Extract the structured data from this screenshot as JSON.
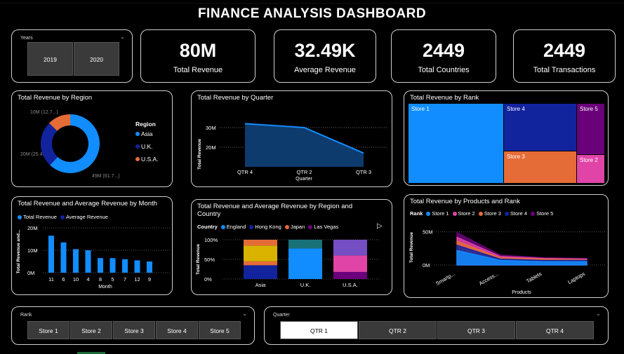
{
  "title": "FINANCE ANALYSIS DASHBOARD",
  "years_slicer": {
    "label": "Years",
    "options": [
      "2019",
      "2020"
    ]
  },
  "kpis": [
    {
      "value": "80M",
      "label": "Total Revenue"
    },
    {
      "value": "32.49K",
      "label": "Average Revenue"
    },
    {
      "value": "2449",
      "label": "Total Countries"
    },
    {
      "value": "2449",
      "label": "Total Transactions"
    }
  ],
  "rank_slicer": {
    "label": "Rank",
    "options": [
      "Store 1",
      "Store 2",
      "Store 3",
      "Store 4",
      "Store 5"
    ]
  },
  "quarter_slicer": {
    "label": "Quarter",
    "options": [
      "QTR 1",
      "QTR 2",
      "QTR 3",
      "QTR 4"
    ],
    "selected": "QTR 1"
  },
  "colors": {
    "blue": "#118dff",
    "navy": "#12239e",
    "orange": "#e66c37",
    "purple": "#6b007b",
    "pink": "#e044a7",
    "darkblue": "#1f3c88",
    "yellow": "#d9b300",
    "teal": "#197278",
    "gold": "#c9a100"
  },
  "chart_data": [
    {
      "id": "region",
      "type": "pie",
      "title": "Total Revenue by Region",
      "legend_title": "Region",
      "legend": [
        "Asia",
        "U.K.",
        "U.S.A."
      ],
      "values": [
        49,
        20,
        10
      ],
      "data_labels": [
        "49M (61.7...)",
        "20M (25.4...)",
        "10M (12.7...)"
      ],
      "colors": [
        "#118dff",
        "#12239e",
        "#e66c37"
      ]
    },
    {
      "id": "quarter",
      "type": "area",
      "title": "Total Revenue by Quarter",
      "categories": [
        "QTR 4",
        "QTR 2",
        "QTR 3"
      ],
      "values": [
        32,
        30,
        17
      ],
      "xlabel": "Quarter",
      "ylabel": "Total Revenue",
      "yticks": [
        "20M",
        "30M"
      ],
      "ylim": [
        10,
        35
      ]
    },
    {
      "id": "rank_treemap",
      "type": "treemap",
      "title": "Total Revenue by Rank",
      "items": [
        {
          "label": "Store 1",
          "color": "#118dff"
        },
        {
          "label": "Store 4",
          "color": "#12239e"
        },
        {
          "label": "Store 3",
          "color": "#e66c37"
        },
        {
          "label": "Store 5",
          "color": "#6b007b"
        },
        {
          "label": "Store 2",
          "color": "#e044a7"
        }
      ]
    },
    {
      "id": "month",
      "type": "bar",
      "title": "Total Revenue and Average Revenue by Month",
      "legend": [
        "Total Revenue",
        "Average Revenue"
      ],
      "legend_colors": [
        "#118dff",
        "#12239e"
      ],
      "categories": [
        "11",
        "6",
        "10",
        "4",
        "8",
        "5",
        "7",
        "12",
        "9"
      ],
      "series": [
        {
          "name": "Total Revenue",
          "values": [
            16.5,
            13.5,
            10.5,
            10,
            6.5,
            6.5,
            6,
            5.5,
            5
          ]
        }
      ],
      "xlabel": "Month",
      "ylabel": "Total Revenue and...",
      "yticks": [
        "0M",
        "10M",
        "20M"
      ],
      "ylim": [
        0,
        20
      ]
    },
    {
      "id": "region_country",
      "type": "bar",
      "title": "Total Revenue and Average Revenue by Region and Country",
      "legend_title": "Country",
      "legend": [
        "England",
        "Hong Kong",
        "Japan",
        "Las Vegas"
      ],
      "legend_colors": [
        "#118dff",
        "#12239e",
        "#e66c37",
        "#6b007b"
      ],
      "categories": [
        "Asia",
        "U.K.",
        "U.S.A."
      ],
      "ylabel": "Total Revenue",
      "yticks": [
        "0%",
        "50%",
        "100%"
      ],
      "stacks": [
        [
          {
            "v": 35,
            "c": "#12239e"
          },
          {
            "v": 10,
            "c": "#e66c37"
          },
          {
            "v": 40,
            "c": "#d9b300"
          },
          {
            "v": 15,
            "c": "#e66c37"
          }
        ],
        [
          {
            "v": 78,
            "c": "#118dff"
          },
          {
            "v": 22,
            "c": "#197278"
          }
        ],
        [
          {
            "v": 18,
            "c": "#6b007b"
          },
          {
            "v": 42,
            "c": "#e044a7"
          },
          {
            "v": 40,
            "c": "#744ec2"
          }
        ]
      ]
    },
    {
      "id": "products_rank",
      "type": "area",
      "title": "Total Revenue by Products and Rank",
      "legend_title": "Rank",
      "legend": [
        "Store 1",
        "Store 2",
        "Store 3",
        "Store 4",
        "Store 5"
      ],
      "legend_colors": [
        "#118dff",
        "#e044a7",
        "#e66c37",
        "#12239e",
        "#6b007b"
      ],
      "categories": [
        "Smartp...",
        "Access...",
        "Tablets",
        "Laptops"
      ],
      "series": [
        {
          "name": "Store 5",
          "values": [
            49,
            15,
            11,
            10
          ]
        },
        {
          "name": "Store 2",
          "values": [
            42,
            13,
            10,
            9
          ]
        },
        {
          "name": "Store 3",
          "values": [
            36,
            11,
            9,
            8
          ]
        },
        {
          "name": "Store 4",
          "values": [
            30,
            9,
            7,
            7
          ]
        },
        {
          "name": "Store 1",
          "values": [
            22,
            7,
            5,
            5
          ]
        }
      ],
      "xlabel": "Products",
      "ylabel": "Total Revenue",
      "yticks": [
        "0M",
        "50M"
      ],
      "ylim": [
        0,
        55
      ]
    }
  ]
}
